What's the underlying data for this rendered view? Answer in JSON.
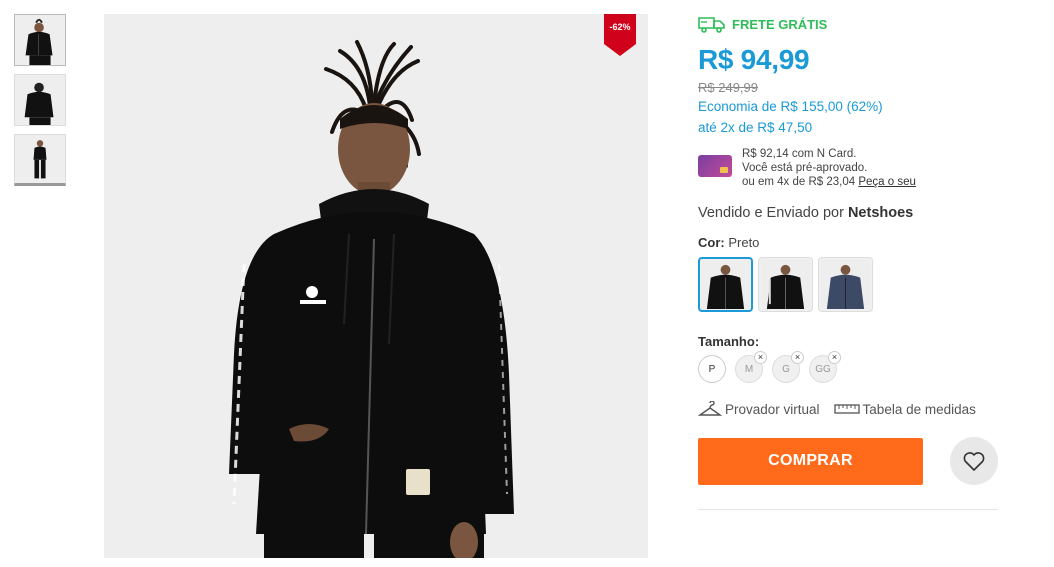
{
  "product": {
    "discount_badge": "-62%",
    "image_alt": "Jaqueta Kappa preta com capuz"
  },
  "thumbnails": [
    {
      "name": "front"
    },
    {
      "name": "back"
    },
    {
      "name": "full-body"
    }
  ],
  "shipping": {
    "label": "FRETE GRÁTIS",
    "icon": "truck-icon"
  },
  "pricing": {
    "price": "R$ 94,99",
    "old_price": "R$ 249,99",
    "economy": "Economia de R$ 155,00 (62%)",
    "installments": "até 2x de R$ 47,50"
  },
  "ncard": {
    "line1": "R$ 92,14 com N Card.",
    "line2": "Você está pré-aprovado.",
    "line3_prefix": "ou em 4x de R$ 23,04 ",
    "link": "Peça o seu"
  },
  "seller": {
    "prefix": "Vendido e Enviado por ",
    "name": "Netshoes"
  },
  "color": {
    "label": "Cor:",
    "value": "Preto",
    "options": [
      {
        "name": "preto-1",
        "selected": true
      },
      {
        "name": "preto-2",
        "selected": false
      },
      {
        "name": "azul",
        "selected": false
      }
    ]
  },
  "size": {
    "label": "Tamanho:",
    "options": [
      {
        "label": "P",
        "available": true
      },
      {
        "label": "M",
        "available": false
      },
      {
        "label": "G",
        "available": false
      },
      {
        "label": "GG",
        "available": false
      }
    ]
  },
  "tools": {
    "virtual_fitting": "Provador virtual",
    "size_table": "Tabela de medidas"
  },
  "actions": {
    "buy": "COMPRAR",
    "favorite_icon": "heart-icon"
  },
  "colors": {
    "price_blue": "#1a9ad6",
    "shipping_green": "#2ebd59",
    "buy_orange": "#ff6b1a",
    "badge_red": "#d0021b"
  }
}
